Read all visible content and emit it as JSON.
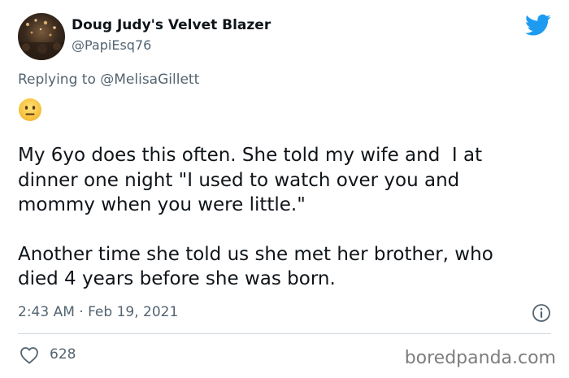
{
  "user": {
    "display_name": "Doug Judy's Velvet Blazer",
    "handle": "@PapiEsq76"
  },
  "reply": {
    "prefix": "Replying to ",
    "mention": "@MelisaGillett"
  },
  "emoji": "neutral-face-emoji",
  "tweet": {
    "paragraph1": "My 6yo does this often. She told my wife and  I at\ndinner one night \"I used to watch over you and\nmommy when you were little.\"",
    "paragraph2": "Another time she told us she met her brother, who\ndied 4 years before she was born."
  },
  "meta": {
    "timestamp": "2:43 AM · Feb 19, 2021"
  },
  "actions": {
    "like_count": "628"
  },
  "watermark": "boredpanda.com",
  "colors": {
    "twitter_blue": "#1d9bf0",
    "secondary_text": "#536471",
    "primary_text": "#0f1419"
  }
}
